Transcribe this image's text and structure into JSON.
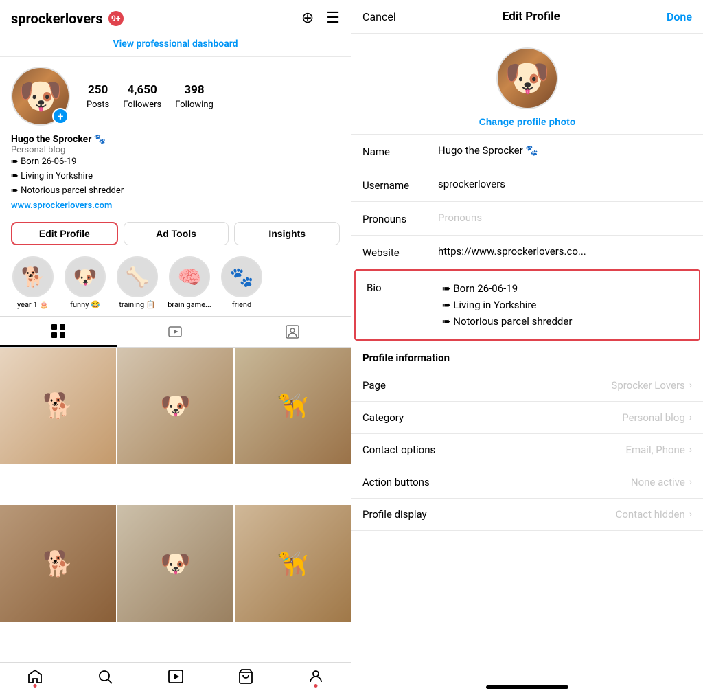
{
  "left": {
    "header": {
      "username": "sprockerlovers",
      "notification_count": "9+",
      "add_icon": "⊕",
      "menu_icon": "☰"
    },
    "pro_dashboard": {
      "link_text": "View professional dashboard"
    },
    "profile": {
      "stats": [
        {
          "number": "250",
          "label": "Posts"
        },
        {
          "number": "4,650",
          "label": "Followers"
        },
        {
          "number": "398",
          "label": "Following"
        }
      ],
      "name": "Hugo the Sprocker 🐾",
      "category": "Personal blog",
      "bio_lines": [
        "➠ Born 26-06-19",
        "➠ Living in Yorkshire",
        "➠ Notorious parcel shredder"
      ],
      "website": "www.sprockerlovers.com"
    },
    "actions": [
      {
        "id": "edit-profile",
        "label": "Edit Profile",
        "highlight": true
      },
      {
        "id": "ad-tools",
        "label": "Ad Tools",
        "highlight": false
      },
      {
        "id": "insights",
        "label": "Insights",
        "highlight": false
      }
    ],
    "stories": [
      {
        "label": "year 1 🎂",
        "emoji": "🐕"
      },
      {
        "label": "funny 😂",
        "emoji": "🐶"
      },
      {
        "label": "training 📋",
        "emoji": "🦴"
      },
      {
        "label": "brain game...",
        "emoji": "🧠"
      },
      {
        "label": "friend",
        "emoji": "🐾"
      }
    ],
    "tabs": [
      {
        "id": "grid",
        "icon": "⊞",
        "active": true
      },
      {
        "id": "video",
        "icon": "▶",
        "active": false
      },
      {
        "id": "tagged",
        "icon": "👤",
        "active": false
      }
    ],
    "photos": [
      "🐕",
      "🐶",
      "🦮",
      "🐕",
      "🐶",
      "🦮"
    ],
    "bottom_nav": [
      {
        "id": "home",
        "icon": "⌂",
        "has_dot": true
      },
      {
        "id": "search",
        "icon": "🔍",
        "has_dot": false
      },
      {
        "id": "reels",
        "icon": "▶",
        "has_dot": false
      },
      {
        "id": "shop",
        "icon": "🛍",
        "has_dot": false
      },
      {
        "id": "profile",
        "icon": "👤",
        "has_dot": true
      }
    ]
  },
  "right": {
    "header": {
      "cancel": "Cancel",
      "title": "Edit Profile",
      "done": "Done"
    },
    "change_photo": "Change profile photo",
    "fields": [
      {
        "id": "name",
        "label": "Name",
        "value": "Hugo the Sprocker 🐾",
        "placeholder": false
      },
      {
        "id": "username",
        "label": "Username",
        "value": "sprockerlovers",
        "placeholder": false
      },
      {
        "id": "pronouns",
        "label": "Pronouns",
        "value": "Pronouns",
        "placeholder": true
      },
      {
        "id": "website",
        "label": "Website",
        "value": "https://www.sprockerlovers.co...",
        "placeholder": false
      },
      {
        "id": "bio",
        "label": "Bio",
        "value": "➠ Born 26-06-19\n➠ Living in Yorkshire\n➠ Notorious parcel shredder",
        "placeholder": false,
        "highlighted": true
      }
    ],
    "profile_information": {
      "header": "Profile information",
      "rows": [
        {
          "id": "page",
          "label": "Page",
          "value": "Sprocker Lovers"
        },
        {
          "id": "category",
          "label": "Category",
          "value": "Personal blog"
        },
        {
          "id": "contact",
          "label": "Contact options",
          "value": "Email, Phone"
        },
        {
          "id": "action-buttons",
          "label": "Action buttons",
          "value": "None active"
        },
        {
          "id": "profile-display",
          "label": "Profile display",
          "value": "Contact hidden"
        }
      ]
    }
  }
}
